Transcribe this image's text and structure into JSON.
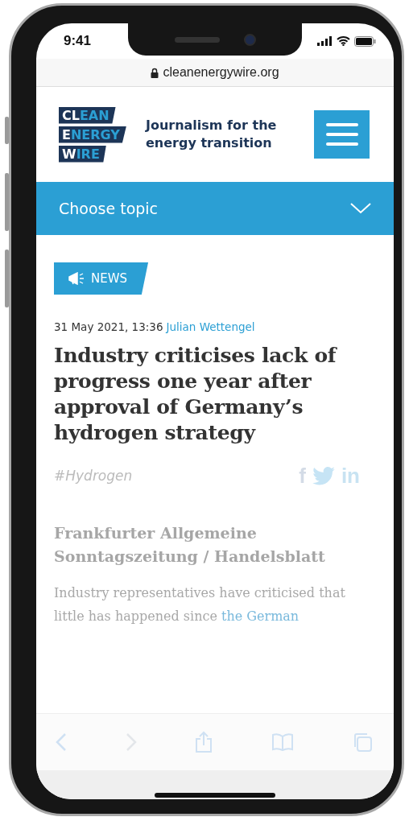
{
  "status_bar": {
    "time": "9:41"
  },
  "address_bar": {
    "url": "cleanenergywire.org"
  },
  "header": {
    "logo": [
      {
        "lead": "CL",
        "rest": "EAN"
      },
      {
        "lead": "E",
        "rest": "NERGY"
      },
      {
        "lead": "W",
        "rest": "IRE"
      }
    ],
    "tagline": "Journalism for the energy transition"
  },
  "topic_menu": {
    "label": "Choose topic"
  },
  "article": {
    "category": "NEWS",
    "date": "31 May 2021, 13:36",
    "author": "Julian Wettengel",
    "headline": "Industry criticises lack of progress one year after approval of Germany’s hydrogen strategy",
    "tag": "#Hydrogen",
    "share": [
      {
        "kind": "facebook",
        "glyph": "f"
      },
      {
        "kind": "twitter"
      },
      {
        "kind": "linkedin",
        "glyph": "in"
      }
    ],
    "source": "Frankfurter Allgemeine Sonntagszeitung / Handelsblatt",
    "body": "Industry representatives have criticised that little has happened since ",
    "body_link": "the German"
  },
  "toolbar": [
    {
      "kind": "back",
      "disabled": false
    },
    {
      "kind": "forward",
      "disabled": true
    },
    {
      "kind": "share",
      "disabled": false
    },
    {
      "kind": "bookmarks",
      "disabled": false
    },
    {
      "kind": "tabs",
      "disabled": false
    }
  ]
}
